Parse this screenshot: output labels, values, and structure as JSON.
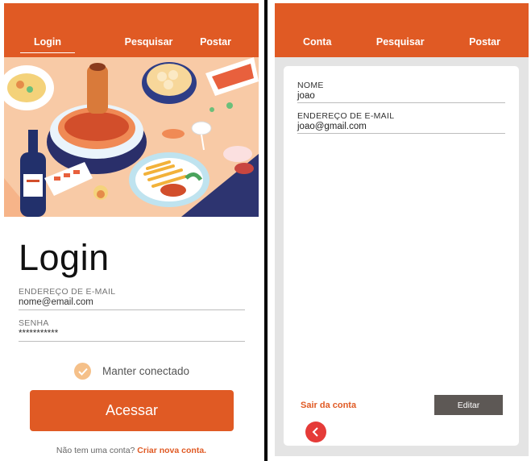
{
  "left_screen": {
    "nav": {
      "login": "Login",
      "search": "Pesquisar",
      "post": "Postar"
    },
    "title": "Login",
    "email": {
      "label": "ENDEREÇO DE E-MAIL",
      "value": "nome@email.com"
    },
    "password": {
      "label": "SENHA",
      "value": "***********"
    },
    "remember_label": "Manter conectado",
    "submit_label": "Acessar",
    "signup_prompt": "Não tem uma conta?",
    "signup_link": "Criar nova conta."
  },
  "right_screen": {
    "nav": {
      "account": "Conta",
      "search": "Pesquisar",
      "post": "Postar"
    },
    "name": {
      "label": "NOME",
      "value": "joao"
    },
    "email": {
      "label": "ENDEREÇO DE E-MAIL",
      "value": "joao@gmail.com"
    },
    "logout_label": "Sair da conta",
    "edit_label": "Editar"
  },
  "colors": {
    "accent": "#e05a24",
    "check": "#f5c089",
    "edit_button": "#5d5855",
    "back_button": "#e53b38"
  },
  "icons": {
    "check": "check-icon",
    "back": "chevron-left-icon"
  }
}
